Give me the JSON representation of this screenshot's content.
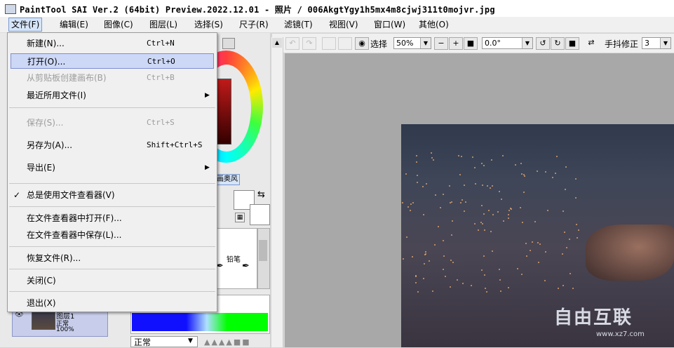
{
  "window": {
    "title": "PaintTool SAI Ver.2 (64bit) Preview.2022.12.01 - 照片 / 006AkgtYgy1h5mx4m8cjwj311t0mojvr.jpg"
  },
  "menubar": {
    "items": [
      {
        "label": "文件(F)"
      },
      {
        "label": "编辑(E)"
      },
      {
        "label": "图像(C)"
      },
      {
        "label": "图层(L)"
      },
      {
        "label": "选择(S)"
      },
      {
        "label": "尺子(R)"
      },
      {
        "label": "滤镜(T)"
      },
      {
        "label": "视图(V)"
      },
      {
        "label": "窗口(W)"
      },
      {
        "label": "其他(O)"
      }
    ]
  },
  "file_menu": {
    "new": {
      "label": "新建(N)...",
      "shortcut": "Ctrl+N"
    },
    "open": {
      "label": "打开(O)...",
      "shortcut": "Ctrl+O"
    },
    "create_from_clipboard": {
      "label": "从剪贴板创建画布(B)",
      "shortcut": "Ctrl+B"
    },
    "recent_files": {
      "label": "最近所用文件(I)"
    },
    "save": {
      "label": "保存(S)...",
      "shortcut": "Ctrl+S"
    },
    "save_as": {
      "label": "另存为(A)...",
      "shortcut": "Shift+Ctrl+S"
    },
    "export": {
      "label": "导出(E)"
    },
    "always_use_viewer": {
      "label": "总是使用文件查看器(V)",
      "checked": true
    },
    "open_in_viewer": {
      "label": "在文件查看器中打开(F)..."
    },
    "save_in_viewer": {
      "label": "在文件查看器中保存(L)..."
    },
    "recover": {
      "label": "恢复文件(R)..."
    },
    "close": {
      "label": "关闭(C)"
    },
    "exit": {
      "label": "退出(X)"
    }
  },
  "toolbar": {
    "selection_label": "选择",
    "zoom_value": "50%",
    "rotation_value": "0.0°",
    "stabilizer_label": "手抖修正",
    "stabilizer_value": "3"
  },
  "color_panel": {
    "bleed_label": "画奥风"
  },
  "brush_panel": {
    "brush_name": "铅笔"
  },
  "layer_panel": {
    "blend_mode": "正常",
    "layer": {
      "name": "图层1",
      "mode": "正常",
      "opacity": "100%"
    }
  },
  "watermark": {
    "text": "自由互联",
    "url": "www.xz7.com"
  },
  "colors": {
    "menu_highlight": "#cdd8f6",
    "disabled_text": "#9c9c9c",
    "canvas_bg": "#a8a8a8"
  }
}
